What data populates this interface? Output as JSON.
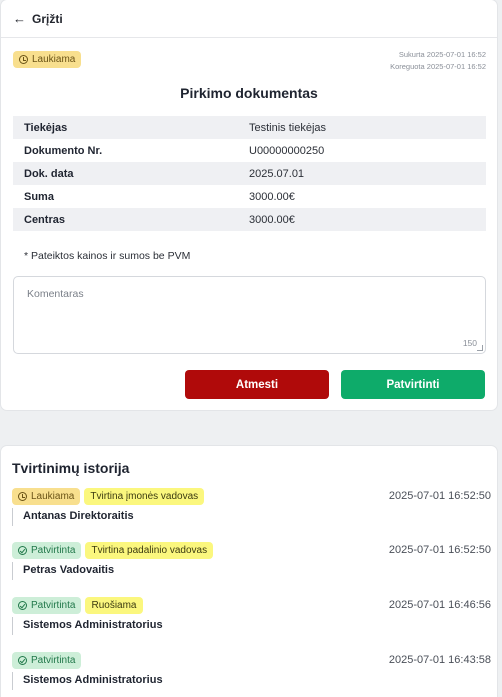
{
  "nav": {
    "back_label": "Grįžti"
  },
  "document": {
    "status": "Laukiama",
    "created": "Sukurta 2025-07-01 16:52",
    "edited": "Koreguota 2025-07-01 16:52",
    "title": "Pirkimo dokumentas",
    "fields": [
      {
        "label": "Tiekėjas",
        "value": "Testinis tiekėjas"
      },
      {
        "label": "Dokumento Nr.",
        "value": "U00000000250"
      },
      {
        "label": "Dok. data",
        "value": "2025.07.01"
      },
      {
        "label": "Suma",
        "value": "3000.00€"
      },
      {
        "label": "Centras",
        "value": "3000.00€"
      }
    ],
    "vat_note": "* Pateiktos kainos ir sumos be PVM"
  },
  "comment": {
    "placeholder": "Komentaras",
    "counter": "150"
  },
  "actions": {
    "reject_label": "Atmesti",
    "approve_label": "Patvirtinti"
  },
  "history": {
    "title": "Tvirtinimų istorija",
    "entries": [
      {
        "status": "Laukiama",
        "step": "Tvirtina įmonės vadovas",
        "time": "2025-07-01 16:52:50",
        "user": "Antanas Direktoraitis"
      },
      {
        "status": "Patvirtinta",
        "step": "Tvirtina padalinio vadovas",
        "time": "2025-07-01 16:52:50",
        "user": "Petras Vadovaitis"
      },
      {
        "status": "Patvirtinta",
        "step": "Ruošiama",
        "time": "2025-07-01 16:46:56",
        "user": "Sistemos Administratorius"
      },
      {
        "status": "Patvirtinta",
        "step": "",
        "time": "2025-07-01 16:43:58",
        "user": "Sistemos Administratorius"
      }
    ]
  },
  "colors": {
    "pending_badge": "#f8df8e",
    "approved_badge": "#cdeed8",
    "step_badge": "#fbf77e",
    "reject_button": "#b00a0a",
    "approve_button": "#0eab6a"
  }
}
